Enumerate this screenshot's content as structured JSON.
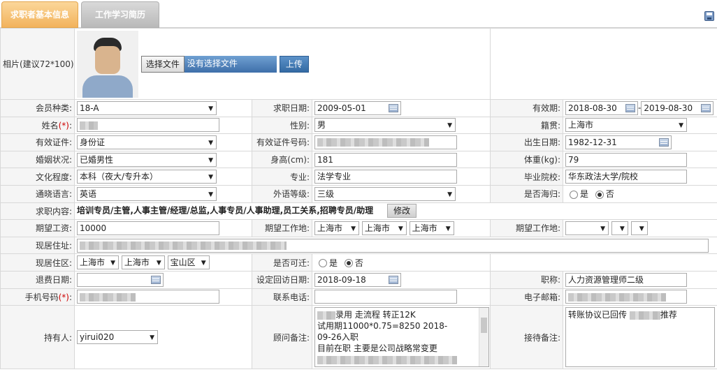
{
  "tabs": [
    "求职者基本信息",
    "工作学习简历"
  ],
  "photo": {
    "label": "相片(建议72*100):",
    "choose_file": "选择文件",
    "no_file": "没有选择文件",
    "upload": "上传"
  },
  "labels": {
    "member_type": "会员种类:",
    "job_date": "求职日期:",
    "valid_period": "有效期:",
    "name": "姓名",
    "gender": "性别:",
    "native": "籍贯:",
    "id_type": "有效证件:",
    "id_number": "有效证件号码:",
    "birth": "出生日期:",
    "marital": "婚姻状况:",
    "height": "身高(cm):",
    "weight": "体重(kg):",
    "education": "文化程度:",
    "major": "专业:",
    "school": "毕业院校:",
    "language": "通晓语言:",
    "lang_level": "外语等级:",
    "overseas": "是否海归:",
    "job_content": "求职内容:",
    "expected_salary": "期望工资:",
    "expected_place1": "期望工作地:",
    "expected_place2": "期望工作地:",
    "current_address": "现居住址:",
    "current_area": "现居住区:",
    "relocate": "是否可迁:",
    "refund_date": "退费日期:",
    "followup_date": "设定回访日期:",
    "title": "职称:",
    "mobile": "手机号码",
    "phone": "联系电话:",
    "email": "电子邮箱:",
    "holder": "持有人:",
    "advisor_note": "顾问备注:",
    "reception_note": "接待备注:",
    "required_mark": "(*)",
    "colon": ":"
  },
  "values": {
    "member_type": "18-A",
    "job_date": "2009-05-01",
    "valid_from": "2018-08-30",
    "valid_sep": "-",
    "valid_to": "2019-08-30",
    "gender": "男",
    "native": "上海市",
    "id_type": "身份证",
    "birth": "1982-12-31",
    "marital": "已婚男性",
    "height": "181",
    "weight": "79",
    "education": "本科（夜大/专升本）",
    "major": "法学专业",
    "school": "华东政法大学/院校",
    "language": "英语",
    "lang_level": "三级",
    "yes": "是",
    "no": "否",
    "job_content": "培训专员/主管,人事主管/经理/总监,人事专员/人事助理,员工关系,招聘专员/助理",
    "edit": "修改",
    "expected_salary": "10000",
    "place1": [
      "上海市",
      "上海市",
      "上海市"
    ],
    "area": [
      "上海市",
      "上海市",
      "宝山区"
    ],
    "followup_date": "2018-09-18",
    "title": "人力资源管理师二级",
    "holder": "yirui020",
    "advisor_note": [
      "录用 走流程 转正12K",
      "试用期11000*0.75=8250 2018-",
      "09-26入职",
      "目前在职 主要是公司战略常变更"
    ],
    "reception_note_a": "转账协议已回传",
    "reception_note_b": "推荐"
  }
}
